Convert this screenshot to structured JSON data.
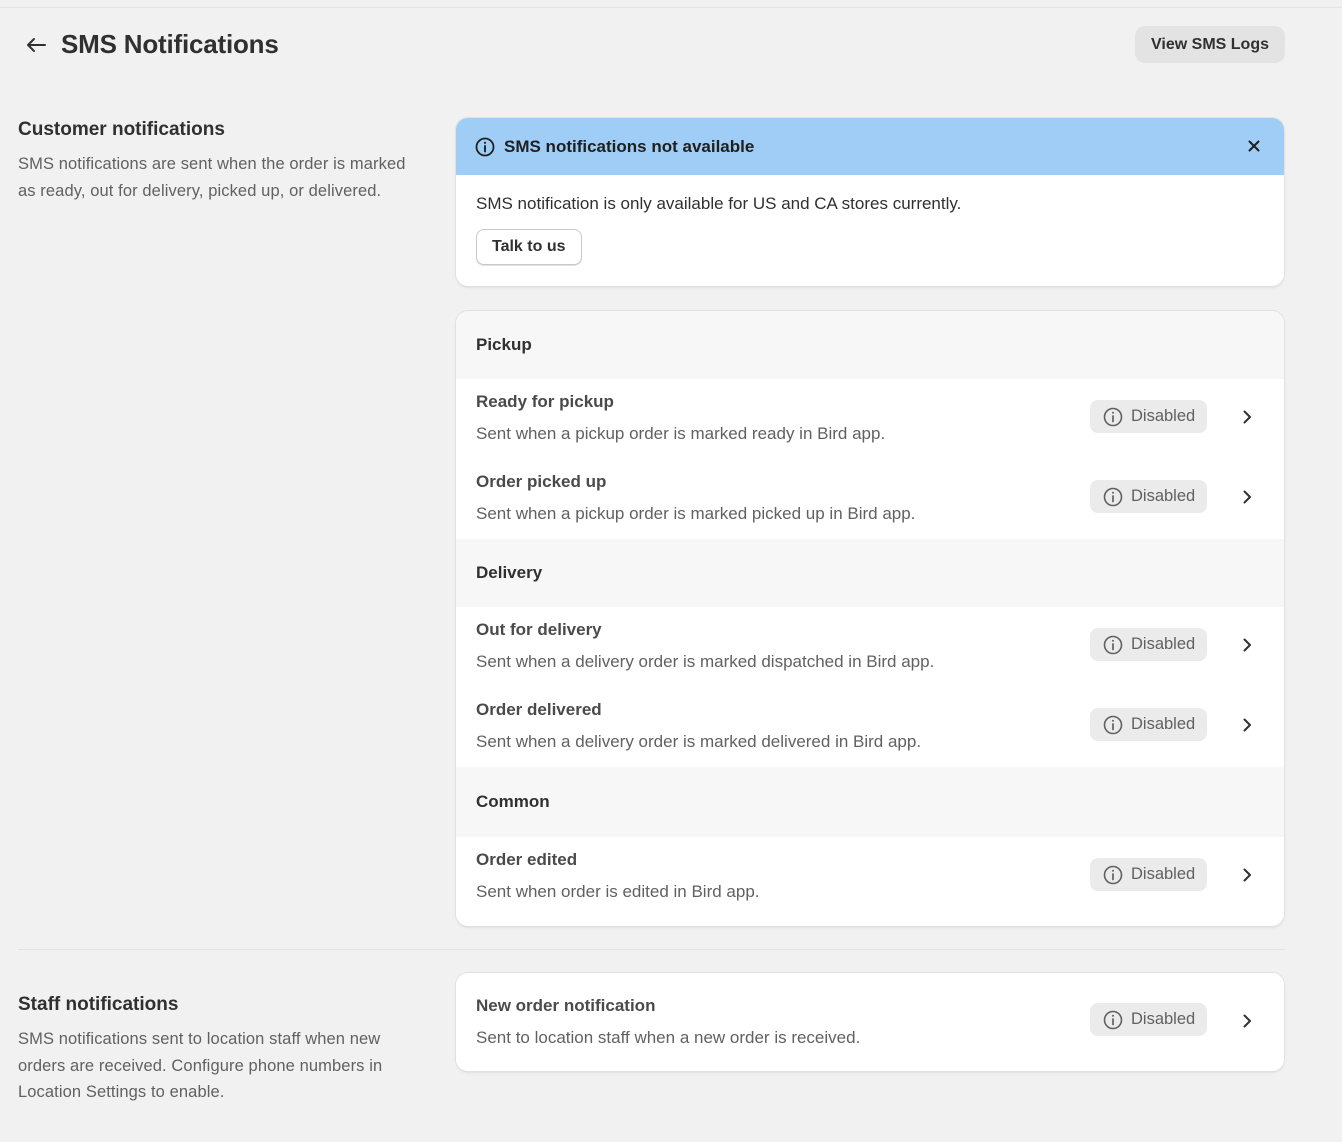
{
  "header": {
    "title": "SMS Notifications",
    "view_logs_label": "View SMS Logs"
  },
  "customer_section": {
    "title": "Customer notifications",
    "description": "SMS notifications are sent when the order is marked as ready, out for delivery, picked up, or delivered."
  },
  "banner": {
    "title": "SMS notifications not available",
    "message": "SMS notification is only available for US and CA stores currently.",
    "button_label": "Talk to us",
    "accent_color": "#9fcdf6"
  },
  "groups": [
    {
      "label": "Pickup",
      "items": [
        {
          "title": "Ready for pickup",
          "description": "Sent when a pickup order is marked ready in Bird app.",
          "status": "Disabled"
        },
        {
          "title": "Order picked up",
          "description": "Sent when a pickup order is marked picked up in Bird app.",
          "status": "Disabled"
        }
      ]
    },
    {
      "label": "Delivery",
      "items": [
        {
          "title": "Out for delivery",
          "description": "Sent when a delivery order is marked dispatched in Bird app.",
          "status": "Disabled"
        },
        {
          "title": "Order delivered",
          "description": "Sent when a delivery order is marked delivered in Bird app.",
          "status": "Disabled"
        }
      ]
    },
    {
      "label": "Common",
      "items": [
        {
          "title": "Order edited",
          "description": "Sent when order is edited in Bird app.",
          "status": "Disabled"
        }
      ]
    }
  ],
  "staff_section": {
    "title": "Staff notifications",
    "description": "SMS notifications sent to location staff when new orders are received. Configure phone numbers in Location Settings to enable.",
    "items": [
      {
        "title": "New order notification",
        "description": "Sent to location staff when a new order is received.",
        "status": "Disabled"
      }
    ]
  },
  "icons": {
    "back": "arrow-left-icon",
    "info": "info-icon",
    "close": "close-icon",
    "chevron": "chevron-right-icon"
  }
}
